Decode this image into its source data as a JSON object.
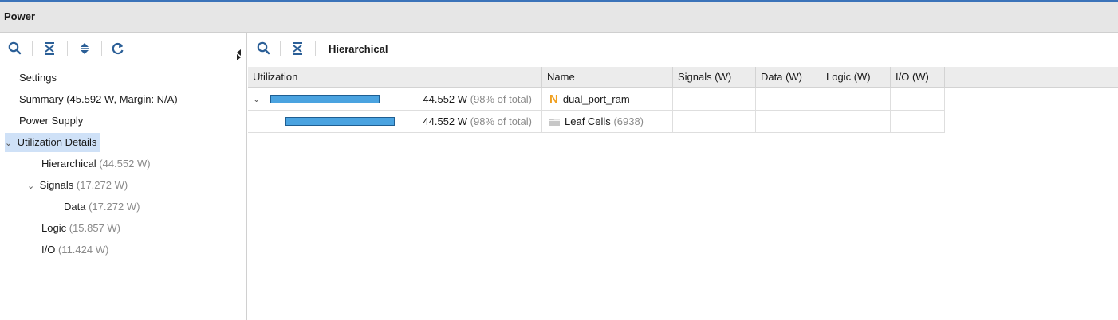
{
  "window": {
    "title": "Power"
  },
  "left_toolbar": {
    "icons": [
      "search-icon",
      "collapse-all-icon",
      "expand-collapse-icon",
      "refresh-icon"
    ]
  },
  "tree": {
    "items": [
      {
        "label": "Settings",
        "value": ""
      },
      {
        "label": "Summary (45.592 W, Margin: N/A)",
        "value": ""
      },
      {
        "label": "Power Supply",
        "value": ""
      },
      {
        "label": "Utilization Details",
        "value": "",
        "selected": true
      },
      {
        "label": "Hierarchical",
        "value": "(44.552 W)"
      },
      {
        "label": "Signals",
        "value": "(17.272 W)"
      },
      {
        "label": "Data",
        "value": "(17.272 W)"
      },
      {
        "label": "Logic",
        "value": "(15.857 W)"
      },
      {
        "label": "I/O",
        "value": "(11.424 W)"
      }
    ]
  },
  "right_toolbar": {
    "title": "Hierarchical",
    "icons": [
      "search-icon",
      "collapse-all-icon"
    ]
  },
  "table": {
    "columns": [
      "Utilization",
      "Name",
      "Signals (W)",
      "Data (W)",
      "Logic (W)",
      "I/O (W)"
    ],
    "rows": [
      {
        "utilization_value": "44.552 W",
        "utilization_pct": "(98% of total)",
        "utilization_fraction": 0.98,
        "name": "dual_port_ram",
        "name_extra": "",
        "icon": "netlist-n-icon",
        "expanded": true,
        "signals": "",
        "data": "",
        "logic": "",
        "io": ""
      },
      {
        "utilization_value": "44.552 W",
        "utilization_pct": "(98% of total)",
        "utilization_fraction": 0.98,
        "name": "Leaf Cells",
        "name_extra": "(6938)",
        "icon": "folder-icon",
        "expanded": false,
        "signals": "",
        "data": "",
        "logic": "",
        "io": ""
      }
    ]
  },
  "colors": {
    "accent": "#3b73b9",
    "bar_fill": "#4aa3e0",
    "selection": "#cfe1f7",
    "n_icon": "#f0a020"
  }
}
